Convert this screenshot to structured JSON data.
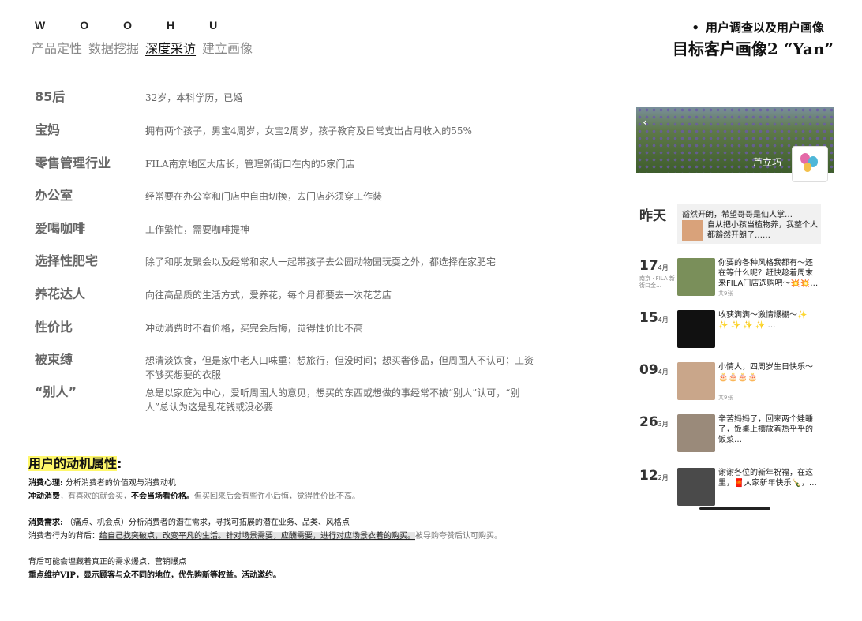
{
  "brand": "WOOHU",
  "nav": [
    "产品定性",
    "数据挖掘",
    "深度采访",
    "建立画像"
  ],
  "nav_active_index": 2,
  "header": {
    "bullet_title": "用户调查以及用户画像",
    "main_title": "目标客户画像2 “Yan”"
  },
  "traits": [
    {
      "label": "85后",
      "desc": "32岁，本科学历，已婚"
    },
    {
      "label": "宝妈",
      "desc": "拥有两个孩子，男宝4周岁，女宝2周岁，孩子教育及日常支出占月收入的55%"
    },
    {
      "label": "零售管理行业",
      "desc": "FILA南京地区大店长，管理新街口在内的5家门店"
    },
    {
      "label": "办公室",
      "desc": "经常要在办公室和门店中自由切换，去门店必须穿工作装"
    },
    {
      "label": "爱喝咖啡",
      "desc": "工作繁忙，需要咖啡提神"
    },
    {
      "label": "选择性肥宅",
      "desc": "除了和朋友聚会以及经常和家人一起带孩子去公园动物园玩耍之外，都选择在家肥宅"
    },
    {
      "label": "养花达人",
      "desc": "向往高品质的生活方式，爱养花，每个月都要去一次花艺店"
    },
    {
      "label": "性价比",
      "desc": "冲动消费时不看价格，买完会后悔，觉得性价比不高"
    },
    {
      "label": "被束缚",
      "desc": "想清淡饮食，但是家中老人口味重；想旅行，但没时间；想买奢侈品，但周围人不认可；工资不够买想要的衣服"
    },
    {
      "label": "“别人”",
      "desc": "总是以家庭为中心，爱听周围人的意见，想买的东西或想做的事经常不被“别人”认可，“别人”总认为这是乱花钱或没必要"
    }
  ],
  "motive": {
    "heading": "用户的动机属性",
    "colon": ":",
    "l1_bold": "消费心理:",
    "l1_text": " 分析消费者的价值观与消费动机",
    "l2_bold": "冲动消费",
    "l2_text": "，有喜欢的就会买，",
    "l2_bold2": "不会当场看价格。",
    "l2_gray": "但买回来后会有些许小后悔，觉得性价比不高。",
    "l3_bold": "消费需求:",
    "l3_text": " （痛点、机会点）分析消费者的潜在需求，寻找可拓展的潜在业务、品类、风格点",
    "l4_text": "消费者行为的背后：",
    "l4_mark": "给自己找突破点，改变平凡的生活。针对场景需要，应酬需要，进行对应场景衣着的购买。",
    "l4_gray": "被导购夸赞后认可购买。",
    "l5_text": "背后可能会埋藏着真正的需求爆点、营销爆点",
    "l6_bold": "重点维护VIP，显示顾客与众不同的地位，优先购新等权益。活动邀约。"
  },
  "feed": {
    "user_name": "芦立巧",
    "back_icon": "chevron-left-icon",
    "yesterday": {
      "date": "昨天",
      "line1": "豁然开朗，希望哥哥是仙人掌…",
      "line2": "自从把小孩当植物养，我整个人都豁然开朗了……"
    },
    "posts": [
      {
        "day": "17",
        "month": "4月",
        "loc": "南京 · FILA 新街口金…",
        "text": "你要的各种风格我都有～还在等什么呢？赶快趁着周末来FILA门店选购吧～💥💥…",
        "count": "共9张",
        "color": "#7a8f5a"
      },
      {
        "day": "15",
        "month": "4月",
        "loc": "",
        "text": "收获满满～激情爆棚～✨ ✨ ✨ ✨ ✨ …",
        "count": "",
        "color": "#111111"
      },
      {
        "day": "09",
        "month": "4月",
        "loc": "",
        "text": "小情人，四周岁生日快乐～🎂🎂🎂🎂",
        "count": "共9张",
        "color": "#c9a68a"
      },
      {
        "day": "26",
        "month": "3月",
        "loc": "",
        "text": "辛苦妈妈了，回来两个娃睡了，饭桌上摆放着热乎乎的饭菜…",
        "count": "",
        "color": "#9a8a7a"
      },
      {
        "day": "12",
        "month": "2月",
        "loc": "",
        "text": "谢谢各位的新年祝福，在这里，🧧大家新年快乐🍾，…",
        "count": "",
        "color": "#4a4a4a"
      }
    ]
  }
}
